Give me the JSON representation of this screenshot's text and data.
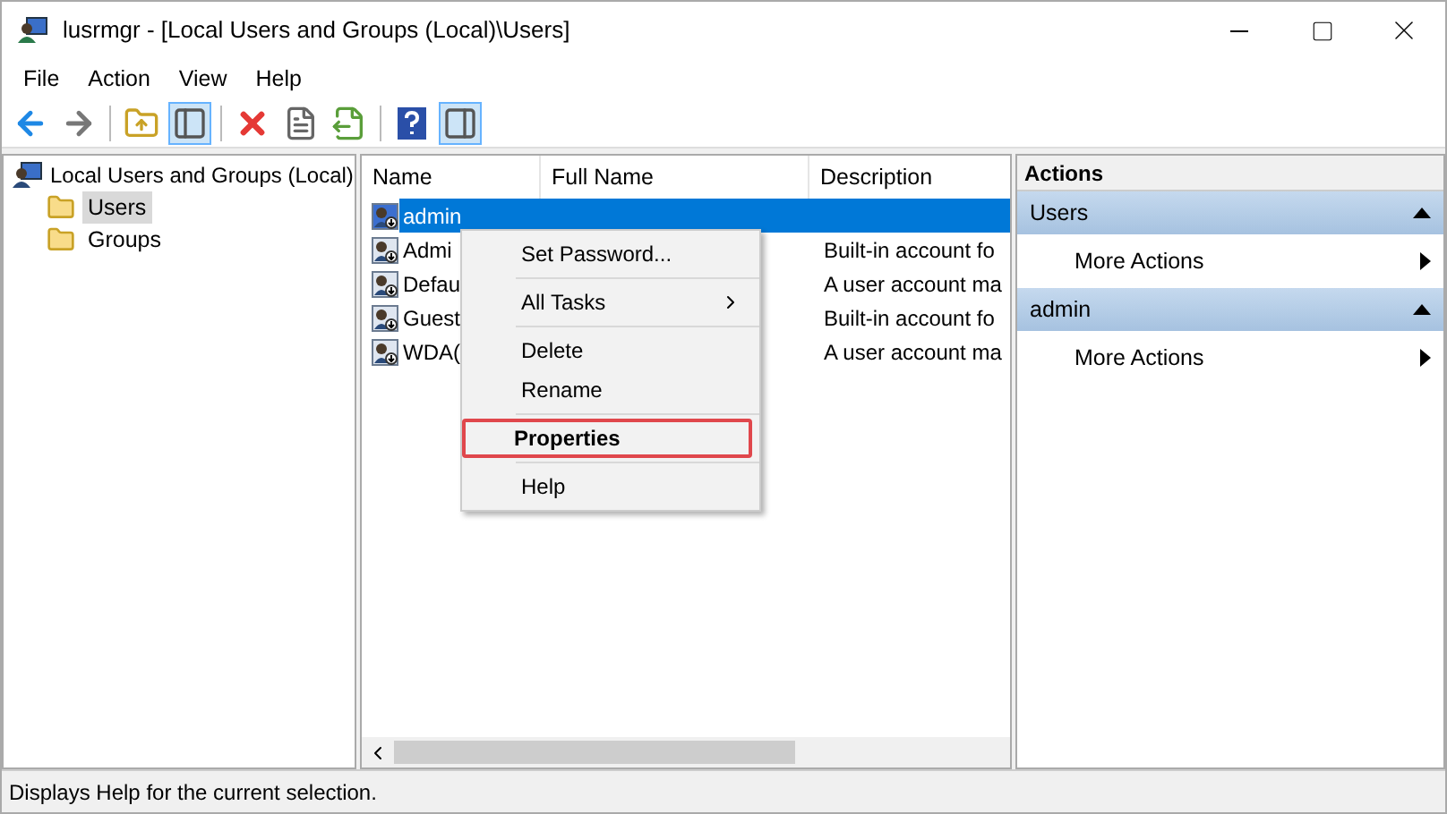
{
  "window": {
    "title": "lusrmgr - [Local Users and Groups (Local)\\Users]"
  },
  "menu": [
    "File",
    "Action",
    "View",
    "Help"
  ],
  "toolbar": [
    [
      {
        "kind": "back",
        "pressed": false
      },
      {
        "kind": "forward",
        "pressed": false
      }
    ],
    [
      {
        "kind": "up",
        "pressed": false
      },
      {
        "kind": "tree",
        "pressed": true
      }
    ],
    [
      {
        "kind": "delete",
        "pressed": false
      },
      {
        "kind": "properties",
        "pressed": false
      },
      {
        "kind": "export",
        "pressed": false
      }
    ],
    [
      {
        "kind": "help",
        "pressed": false
      },
      {
        "kind": "actionpane",
        "pressed": true
      }
    ]
  ],
  "tree": {
    "label": "Local Users and Groups (Local)",
    "children": [
      {
        "label": "Users",
        "selected": true
      },
      {
        "label": "Groups",
        "selected": false
      }
    ]
  },
  "table": {
    "columns": [
      "Name",
      "Full Name",
      "Description"
    ],
    "rows": [
      {
        "name": "admin",
        "selected": true
      },
      {
        "name": "Admi",
        "description": "Built-in account fo",
        "selected": false
      },
      {
        "name": "Defau",
        "description": "A user account ma",
        "selected": false
      },
      {
        "name": "Guest",
        "description": "Built-in account fo",
        "selected": false
      },
      {
        "name": "WDA(",
        "description": "A user account ma",
        "selected": false
      }
    ]
  },
  "context_menu": [
    [
      {
        "label": "Set Password...",
        "kind": "item",
        "bold": false,
        "highlighted": false
      }
    ],
    [
      {
        "label": "All Tasks",
        "kind": "submenu",
        "bold": false,
        "highlighted": false
      }
    ],
    [
      {
        "label": "Delete",
        "kind": "item",
        "bold": false,
        "highlighted": false
      },
      {
        "label": "Rename",
        "kind": "item",
        "bold": false,
        "highlighted": false
      }
    ],
    [
      {
        "label": "Properties",
        "kind": "item",
        "bold": true,
        "highlighted": true
      }
    ],
    [
      {
        "label": "Help",
        "kind": "item",
        "bold": false,
        "highlighted": false
      }
    ]
  ],
  "actions": {
    "title": "Actions",
    "sections": [
      {
        "title": "Users",
        "items": [
          "More Actions"
        ]
      },
      {
        "title": "admin",
        "items": [
          "More Actions"
        ]
      }
    ]
  },
  "status_bar": "Displays Help for the current selection."
}
